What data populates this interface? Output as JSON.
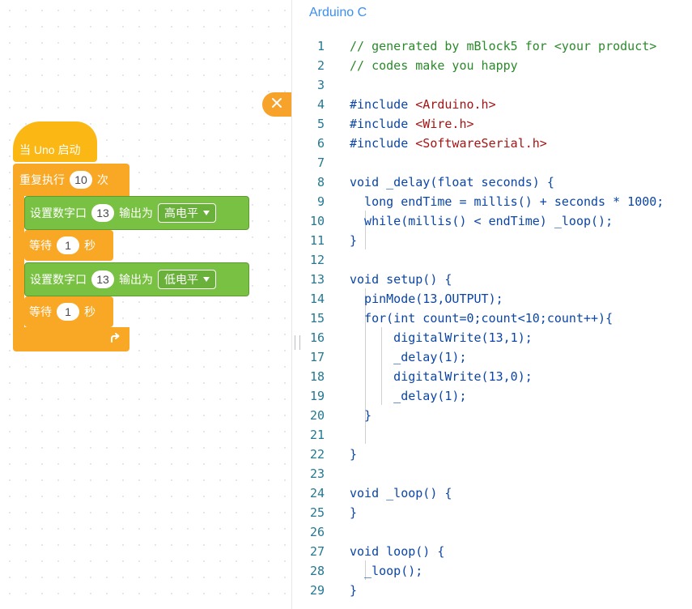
{
  "panel": {
    "title": "Arduino C"
  },
  "blocks": {
    "hat_label": "当 Uno 启动",
    "repeat": {
      "label": "重复执行",
      "count": "10",
      "suffix": "次"
    },
    "set_pin_1": {
      "label": "设置数字口",
      "pin": "13",
      "output_label": "输出为",
      "level": "高电平"
    },
    "wait_1": {
      "label": "等待",
      "seconds": "1",
      "unit": "秒"
    },
    "set_pin_2": {
      "label": "设置数字口",
      "pin": "13",
      "output_label": "输出为",
      "level": "低电平"
    },
    "wait_2": {
      "label": "等待",
      "seconds": "1",
      "unit": "秒"
    }
  },
  "code": {
    "lines": [
      "// generated by mBlock5 for <your product>",
      "// codes make you happy",
      "",
      "#include <Arduino.h>",
      "#include <Wire.h>",
      "#include <SoftwareSerial.h>",
      "",
      "void _delay(float seconds) {",
      "  long endTime = millis() + seconds * 1000;",
      "  while(millis() < endTime) _loop();",
      "}",
      "",
      "void setup() {",
      "  pinMode(13,OUTPUT);",
      "  for(int count=0;count<10;count++){",
      "      digitalWrite(13,1);",
      "      _delay(1);",
      "      digitalWrite(13,0);",
      "      _delay(1);",
      "  }",
      "",
      "}",
      "",
      "void _loop() {",
      "}",
      "",
      "void loop() {",
      "  _loop();",
      "}"
    ]
  },
  "colors": {
    "accent": "#3b8ff0",
    "event_block": "#fbb814",
    "control_block": "#f9a825",
    "pin_block": "#79c143",
    "comment": "#2b8a2b",
    "string": "#a31515",
    "keyword": "#0b45a6",
    "line_number": "#237893"
  },
  "icons": {
    "close": "close-icon",
    "loop_arrow": "loop-arrow-icon",
    "dropdown": "caret-down-icon",
    "resize": "resize-handle-icon"
  }
}
